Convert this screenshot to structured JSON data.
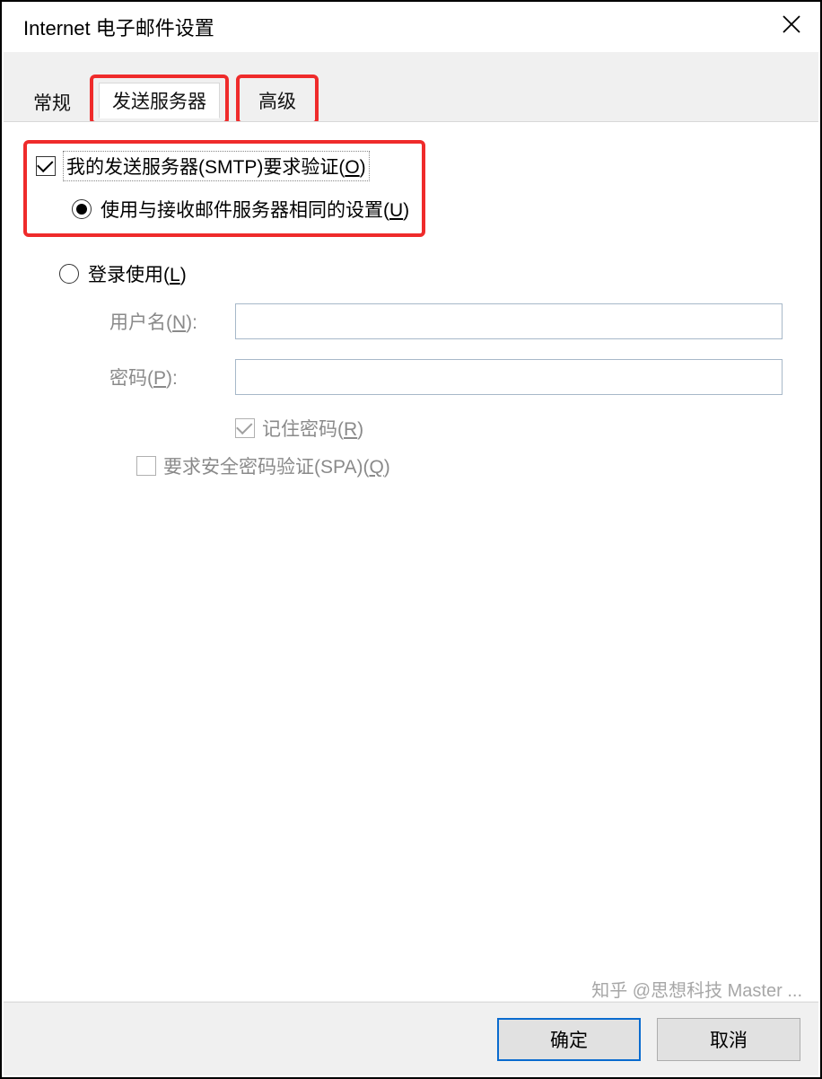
{
  "window": {
    "title": "Internet 电子邮件设置"
  },
  "tabs": {
    "general": "常规",
    "outgoing": "发送服务器",
    "advanced": "高级"
  },
  "smtp": {
    "require_auth_pre": "我的发送服务器(SMTP)要求验证(",
    "require_auth_key": "O",
    "require_auth_post": ")",
    "use_same_pre": "使用与接收邮件服务器相同的设置(",
    "use_same_key": "U",
    "use_same_post": ")",
    "login_pre": "登录使用(",
    "login_key": "L",
    "login_post": ")"
  },
  "fields": {
    "username_pre": "用户名(",
    "username_key": "N",
    "username_post": "):",
    "password_pre": "密码(",
    "password_key": "P",
    "password_post": "):",
    "remember_pre": "记住密码(",
    "remember_key": "R",
    "remember_post": ")",
    "spa_pre": "要求安全密码验证(SPA)(",
    "spa_key": "Q",
    "spa_post": ")"
  },
  "buttons": {
    "ok": "确定",
    "cancel": "取消"
  },
  "watermark": "知乎 @思想科技 Master ..."
}
